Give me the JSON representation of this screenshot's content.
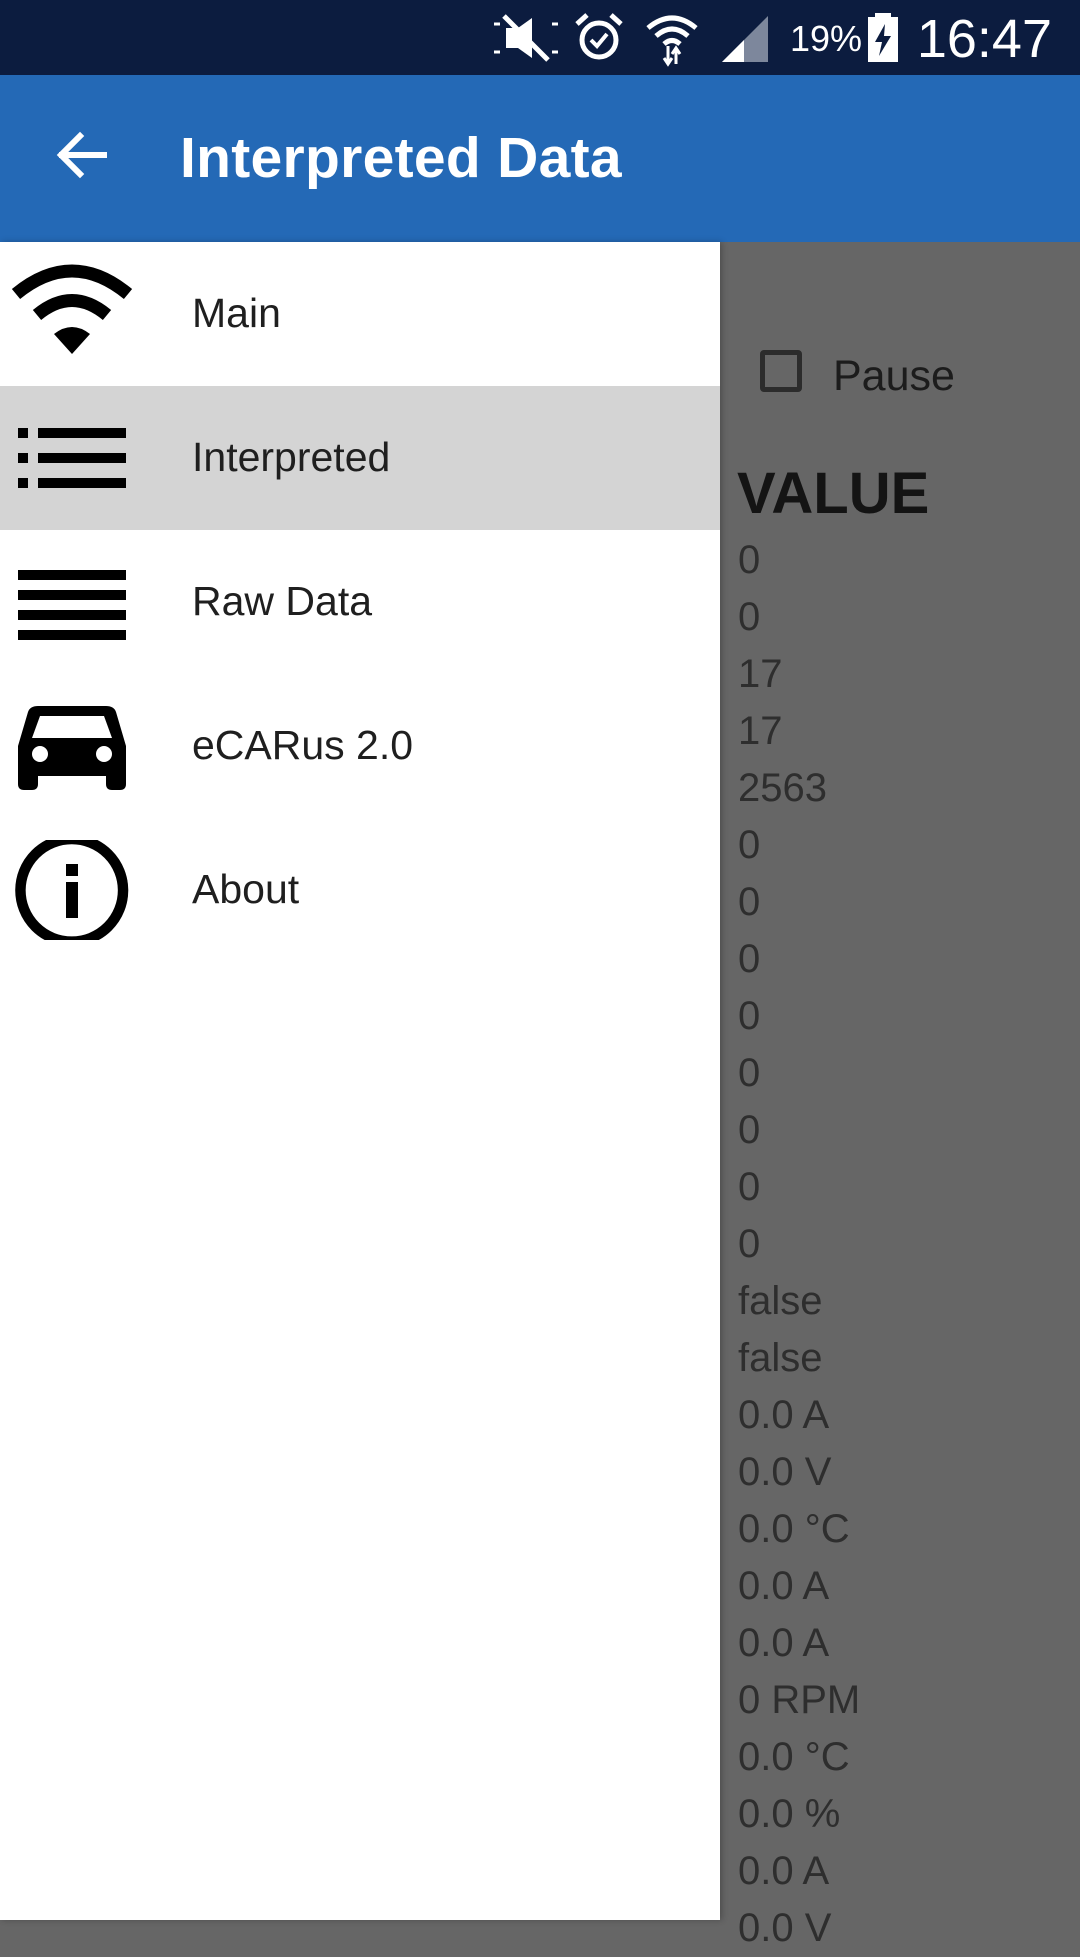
{
  "status_bar": {
    "battery_percent": "19%",
    "time": "16:47",
    "icons": [
      "mute-icon",
      "alarm-icon",
      "wifi-icon",
      "cell-signal-icon",
      "battery-charging-icon"
    ]
  },
  "app_bar": {
    "title": "Interpreted Data",
    "back_icon": "arrow-back-icon"
  },
  "drawer": {
    "items": [
      {
        "label": "Main",
        "icon": "wifi-icon",
        "active": false
      },
      {
        "label": "Interpreted",
        "icon": "list-icon",
        "active": true
      },
      {
        "label": "Raw Data",
        "icon": "lines-icon",
        "active": false
      },
      {
        "label": "eCARus 2.0",
        "icon": "car-icon",
        "active": false
      },
      {
        "label": "About",
        "icon": "info-icon",
        "active": false
      }
    ]
  },
  "content": {
    "pause_label": "Pause",
    "pause_checked": false,
    "value_header": "VALUE",
    "values": [
      "0",
      "0",
      "17",
      "17",
      "2563",
      "0",
      "0",
      "0",
      "0",
      "0",
      "0",
      "0",
      "0",
      "false",
      "false",
      "0.0 A",
      "0.0 V",
      "0.0 °C",
      "0.0 A",
      "0.0 A",
      "0 RPM",
      "0.0 °C",
      "0.0 %",
      "0.0 A",
      "0.0 V"
    ]
  },
  "colors": {
    "status_bar": "#0c1c3f",
    "app_bar": "#2469b6",
    "scrim": "#666666",
    "active_item": "#d4d4d4"
  }
}
